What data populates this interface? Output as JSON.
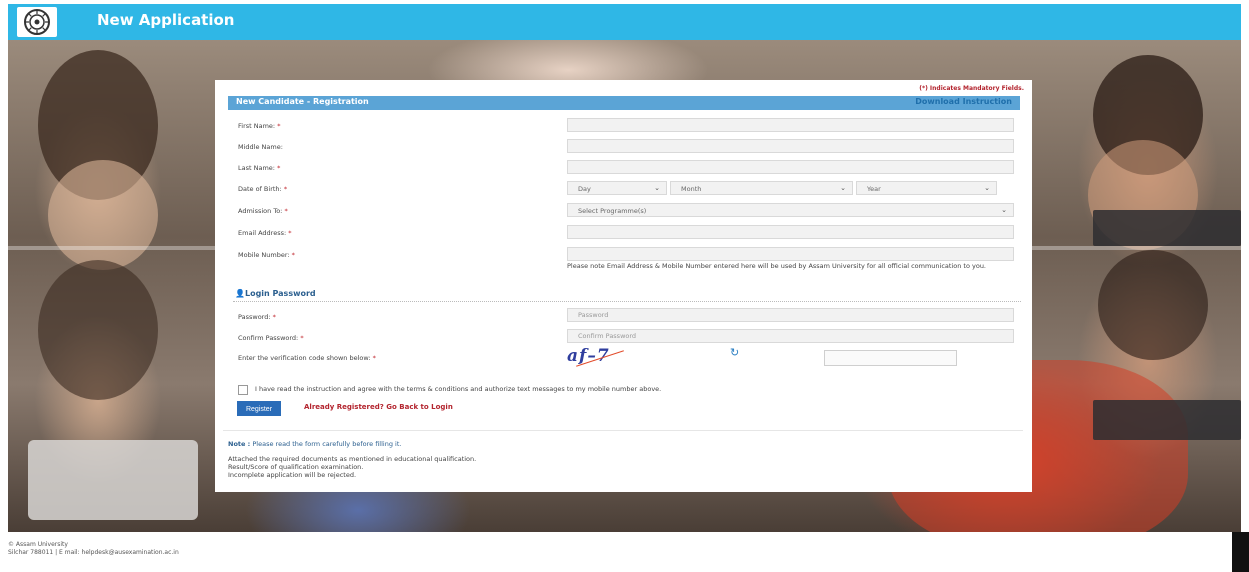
{
  "header": {
    "title": "New Application",
    "color": "#2fb7e6"
  },
  "form": {
    "mandatory_note": "(*) Indicates Mandatory Fields.",
    "section_title": "New Candidate - Registration",
    "download_link": "Download Instruction",
    "fields": {
      "first_name": "First Name:",
      "middle_name": "Middle Name:",
      "last_name": "Last Name:",
      "dob": "Date of Birth:",
      "admission": "Admission To:",
      "email": "Email Address:",
      "mobile": "Mobile Number:"
    },
    "required_mark": "*",
    "dob_selects": {
      "day": "Day",
      "month": "Month",
      "year": "Year"
    },
    "admission_select": "Select Programme(s)",
    "contact_note": "Please note Email Address & Mobile Number entered here will be used by Assam University for all official communication to you.",
    "login_section": "Login Password",
    "password_label": "Password:",
    "password_placeholder": "Password",
    "confirm_label": "Confirm Password:",
    "confirm_placeholder": "Confirm Password",
    "captcha_label": "Enter the verification code shown below:",
    "captcha_text": "af–7",
    "agree_text": "I have read the instruction and agree with the terms & conditions and authorize text messages to my mobile number above.",
    "register_label": "Register",
    "back_to_login": "Already Registered? Go Back to Login"
  },
  "notes": {
    "note_label": "Note :",
    "note_text": "Please read the form carefully before filling it.",
    "items": [
      "Attached the required documents as mentioned in educational qualification.",
      "Result/Score of qualification examination.",
      "Incomplete application will be rejected."
    ]
  },
  "footer": {
    "line1": "© Assam University",
    "line2": "Silchar 788011 | E mail: helpdesk@ausexamination.ac.in"
  }
}
